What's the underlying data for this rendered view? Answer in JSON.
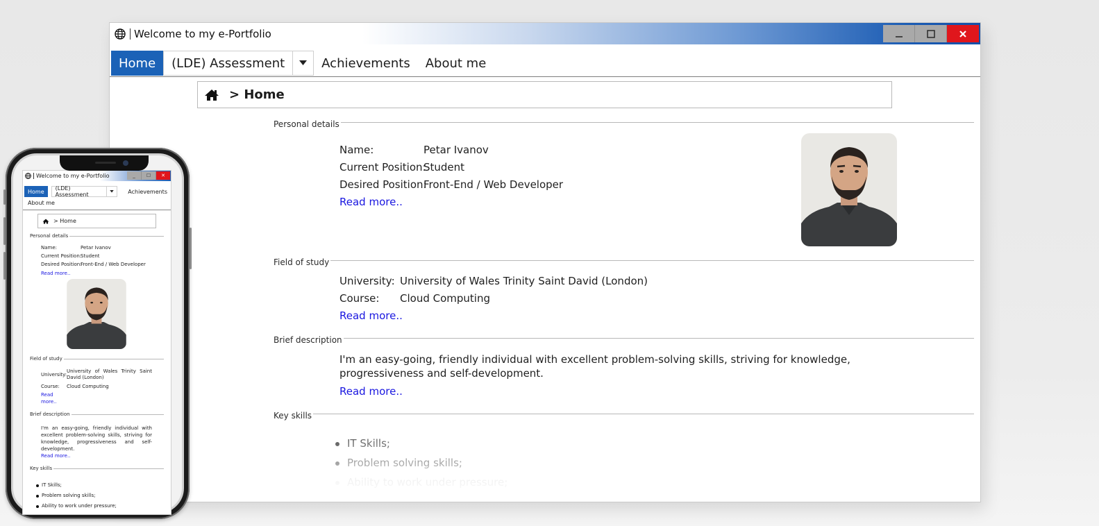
{
  "window": {
    "title": "Welcome to my e-Portfolio",
    "controls": {
      "minimize": "_",
      "maximize": "☐",
      "close": "✕"
    }
  },
  "menu": {
    "home": "Home",
    "assessment": "(LDE) Assessment",
    "achievements": "Achievements",
    "about": "About me"
  },
  "breadcrumb": {
    "text": "> Home"
  },
  "sections": {
    "personal": "Personal details",
    "study": "Field of study",
    "brief": "Brief description",
    "skills": "Key skills"
  },
  "personal": {
    "name_label": "Name:",
    "name_value": "Petar Ivanov",
    "current_label": "Current Position:",
    "current_value": "Student",
    "desired_label": "Desired Position:",
    "desired_value": "Front-End / Web Developer",
    "read_more": "Read more.."
  },
  "study": {
    "university_label": "University:",
    "university_value": "University of Wales Trinity Saint David (London)",
    "course_label": "Course:",
    "course_value": "Cloud Computing",
    "read_more": "Read more.."
  },
  "brief": {
    "text": "I'm an easy-going, friendly individual with excellent problem-solving skills, striving for knowledge, progressiveness and self-development.",
    "read_more": "Read more.."
  },
  "skills": [
    "IT Skills;",
    "Problem solving skills;",
    "Ability to work under pressure;"
  ],
  "mobile": {
    "read_line1": "Read",
    "read_line2": "more.."
  },
  "colors": {
    "accent": "#1b62b7",
    "link": "#1a17e0",
    "close": "#e0161c"
  }
}
